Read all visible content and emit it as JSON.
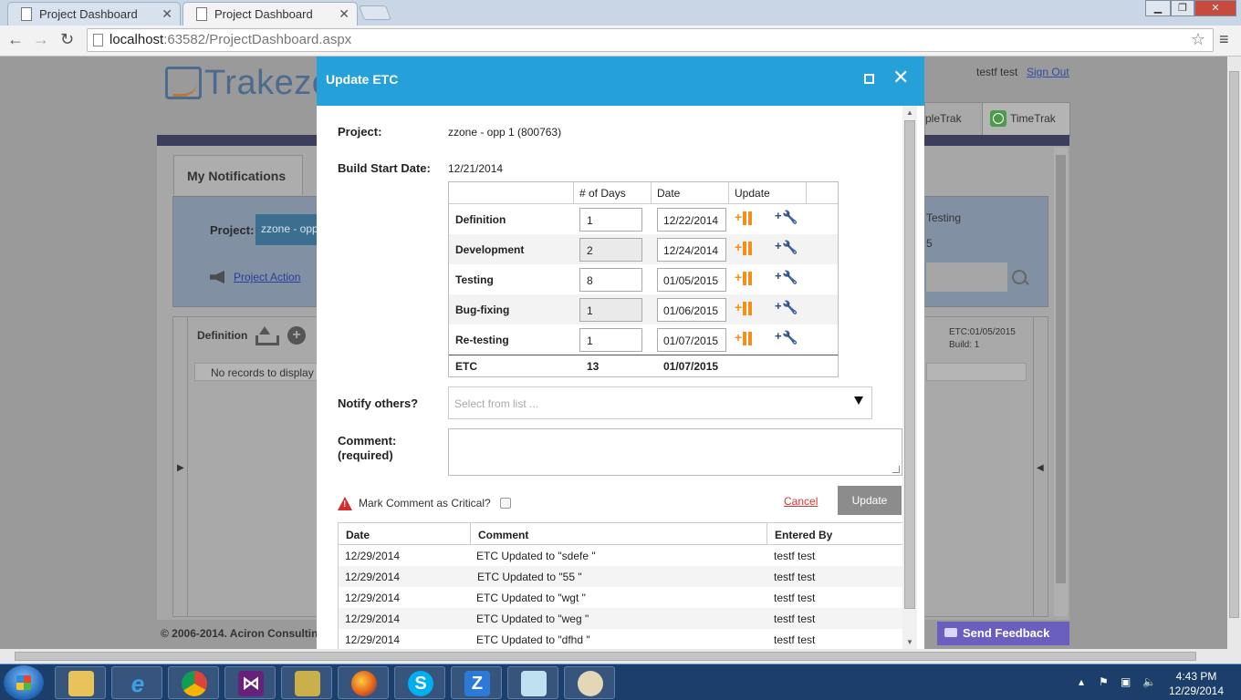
{
  "browser": {
    "tabs": [
      {
        "title": "Project Dashboard"
      },
      {
        "title": "Project Dashboard"
      }
    ],
    "url_host": "localhost",
    "url_rest": ":63582/ProjectDashboard.aspx"
  },
  "header": {
    "logo_text": "Trakeze",
    "user_name": "testf test",
    "sign_out": "Sign Out",
    "nav": {
      "peopletrak": "pleTrak",
      "timetrak": "TimeTrak"
    }
  },
  "background": {
    "notifications_tab": "My Notifications",
    "project_label": "Project:",
    "project_value": "zzone - opp",
    "project_action": "Project Action",
    "right_label": "Testing",
    "right_number": "5",
    "definition_label": "Definition",
    "no_records": "No records to display",
    "etc_info_line1": "ETC:01/05/2015",
    "etc_info_line2": "Build: 1",
    "footer": "© 2006-2014. Aciron Consultin",
    "send_feedback": "Send Feedback"
  },
  "modal": {
    "title": "Update ETC",
    "project_label": "Project:",
    "project_value": "zzone - opp 1 (800763)",
    "build_start_label": "Build Start Date:",
    "build_start_value": "12/21/2014",
    "table_headers": {
      "days": "# of Days",
      "date": "Date",
      "update": "Update"
    },
    "phases": [
      {
        "name": "Definition",
        "days": "1",
        "date": "12/22/2014"
      },
      {
        "name": "Development",
        "days": "2",
        "date": "12/24/2014"
      },
      {
        "name": "Testing",
        "days": "8",
        "date": "01/05/2015"
      },
      {
        "name": "Bug-fixing",
        "days": "1",
        "date": "01/06/2015"
      },
      {
        "name": "Re-testing",
        "days": "1",
        "date": "01/07/2015"
      }
    ],
    "etc_total": {
      "label": "ETC",
      "days": "13",
      "date": "01/07/2015"
    },
    "notify_label": "Notify others?",
    "notify_placeholder": "Select from list ...",
    "comment_label": "Comment:",
    "comment_required": "(required)",
    "critical_label": "Mark Comment as Critical?",
    "cancel": "Cancel",
    "update": "Update",
    "history_headers": {
      "date": "Date",
      "comment": "Comment",
      "entered_by": "Entered By"
    },
    "history": [
      {
        "date": "12/29/2014",
        "comment": "ETC Updated to \"sdefe \"",
        "by": "testf test"
      },
      {
        "date": "12/29/2014",
        "comment": "ETC Updated to \"55 \"",
        "by": "testf test"
      },
      {
        "date": "12/29/2014",
        "comment": "ETC Updated to \"wgt \"",
        "by": "testf test"
      },
      {
        "date": "12/29/2014",
        "comment": "ETC Updated to \"weg \"",
        "by": "testf test"
      },
      {
        "date": "12/29/2014",
        "comment": "ETC Updated to \"dfhd \"",
        "by": "testf test"
      }
    ]
  },
  "taskbar": {
    "time": "4:43 PM",
    "date": "12/29/2014",
    "z_label": "Z",
    "skype_label": "S"
  },
  "colors": {
    "modal_header": "#25a0d9",
    "insert_icon": "#f39019",
    "tool_icon": "#2f4c77",
    "cancel_link": "#dd3333",
    "update_button": "#8c8c8c",
    "send_feedback": "#6a5fbf"
  }
}
